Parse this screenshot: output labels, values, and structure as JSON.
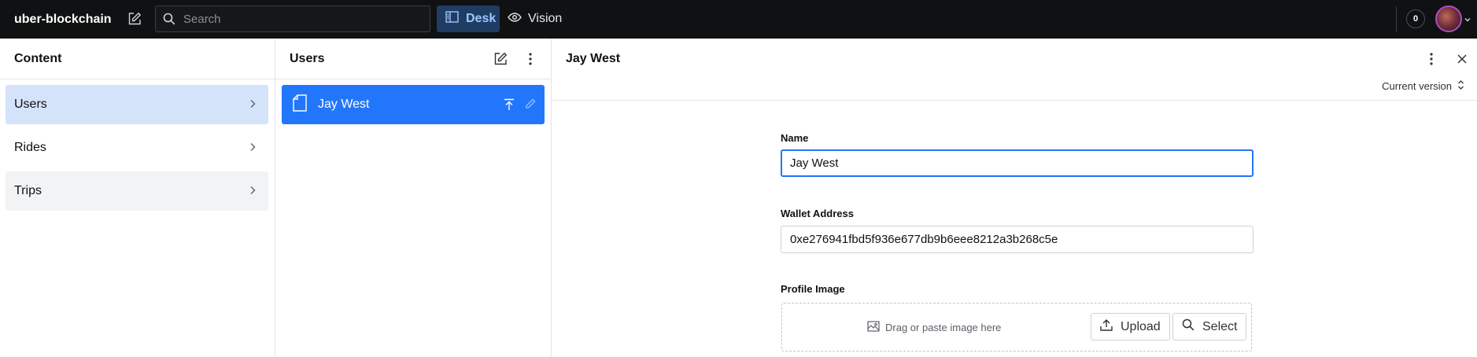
{
  "topbar": {
    "brand": "uber-blockchain",
    "search_placeholder": "Search",
    "tools": [
      {
        "label": "Desk",
        "active": true
      },
      {
        "label": "Vision",
        "active": false
      }
    ],
    "notification_count": "0"
  },
  "content_pane": {
    "title": "Content",
    "items": [
      {
        "label": "Users",
        "state": "selected"
      },
      {
        "label": "Rides",
        "state": "normal"
      },
      {
        "label": "Trips",
        "state": "hover"
      }
    ]
  },
  "users_pane": {
    "title": "Users",
    "documents": [
      {
        "label": "Jay West",
        "selected": true
      }
    ]
  },
  "document_pane": {
    "title": "Jay West",
    "version_label": "Current version",
    "fields": {
      "name": {
        "label": "Name",
        "value": "Jay West"
      },
      "wallet": {
        "label": "Wallet Address",
        "value": "0xe276941fbd5f936e677db9b6eee8212a3b268c5e"
      },
      "profile_image": {
        "label": "Profile Image",
        "hint": "Drag or paste image here",
        "upload_label": "Upload",
        "select_label": "Select"
      }
    }
  },
  "colors": {
    "accent": "#2276fc",
    "selected_bg": "#d4e3fa",
    "topbar_bg": "#101112"
  }
}
